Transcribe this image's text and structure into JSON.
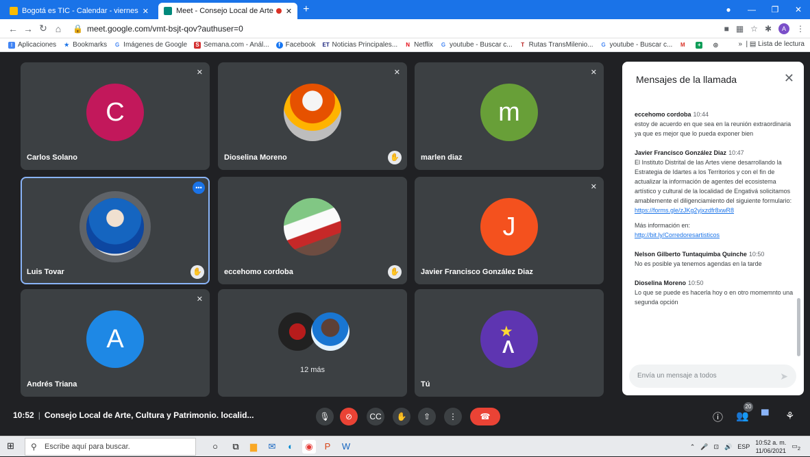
{
  "browser": {
    "tabs": [
      {
        "label": "Bogotá es TIC - Calendar - viernes",
        "icon": "calendar-icon",
        "active": false
      },
      {
        "label": "Meet - Consejo Local de Arte",
        "icon": "meet-icon",
        "active": true
      }
    ],
    "url": "meet.google.com/vmt-bsjt-qov?authuser=0",
    "profile_letter": "A",
    "bookmarks": [
      {
        "label": "Aplicaciones",
        "icon": "apps-grid-icon"
      },
      {
        "label": "Bookmarks",
        "icon": "star-icon"
      },
      {
        "label": "Imágenes de Google",
        "icon": "google-icon"
      },
      {
        "label": "Semana.com - Anál...",
        "icon": "semana-icon"
      },
      {
        "label": "Facebook",
        "icon": "facebook-icon"
      },
      {
        "label": "Noticias Principales...",
        "icon": "et-icon"
      },
      {
        "label": "Netflix",
        "icon": "netflix-icon"
      },
      {
        "label": "youtube - Buscar c...",
        "icon": "google-icon"
      },
      {
        "label": "Rutas TransMilenio...",
        "icon": "transmilenio-icon"
      },
      {
        "label": "youtube - Buscar c...",
        "icon": "google-icon"
      }
    ],
    "reading_list": "Lista de lectura"
  },
  "participants": [
    {
      "name": "Carlos Solano",
      "initial": "C",
      "color": "#c2185b",
      "muted": true
    },
    {
      "name": "Dioselina Moreno",
      "photo": true,
      "hand_raised": true,
      "muted": true
    },
    {
      "name": "marlen diaz",
      "initial": "m",
      "color": "#689f38",
      "muted": true
    },
    {
      "name": "Luis Tovar",
      "photo": true,
      "speaking": true,
      "hand_raised": true
    },
    {
      "name": "eccehomo cordoba",
      "photo": true,
      "hand_raised": true
    },
    {
      "name": "Javier Francisco González Diaz",
      "initial": "J",
      "color": "#f4511e",
      "muted": true
    },
    {
      "name": "Andrés Triana",
      "initial": "A",
      "color": "#1e88e5",
      "muted": true
    },
    {
      "name": "",
      "more_label": "12 más"
    },
    {
      "name": "Tú",
      "photo": true
    }
  ],
  "chat": {
    "title": "Mensajes de la llamada",
    "messages": [
      {
        "sender": "eccehomo cordoba",
        "time": "10:44",
        "text": "estoy de acuerdo en que sea en la reunión extraordinaria ya que es mejor que lo pueda exponer bien"
      },
      {
        "sender": "Javier Francisco González Diaz",
        "time": "10:47",
        "text": "El Instituto Distrital de las Artes viene desarrollando la Estrategia de Idartes a los Territorios y con el fin de actualizar la información de agentes del ecosistema artístico y cultural de la localidad de Engativá solicitamos amablemente el diligenciamiento del siguiente formulario:",
        "link": "https://forms.gle/zJKg2yjxzdfr8xwR8",
        "extra": "Más información en:",
        "link2": "http://bit.ly/Corredoresartisticos"
      },
      {
        "sender": "Nelson Gilberto Tuntaquimba Quinche",
        "time": "10:50",
        "text": "No es posible ya tenemos agendas en la tarde"
      },
      {
        "sender": "Dioselina Moreno",
        "time": "10:50",
        "text": "Lo que se puede es hacerla hoy o en otro momemnto una segunda opción"
      }
    ],
    "input_placeholder": "Envía un mensaje a todos"
  },
  "meeting": {
    "time": "10:52",
    "title": "Consejo Local de Arte, Cultura y Patrimonio. localid...",
    "participant_count": "20"
  },
  "taskbar": {
    "search_placeholder": "Escribe aquí para buscar.",
    "language": "ESP",
    "clock_time": "10:52 a. m.",
    "clock_date": "11/06/2021",
    "notification_count": "2"
  }
}
